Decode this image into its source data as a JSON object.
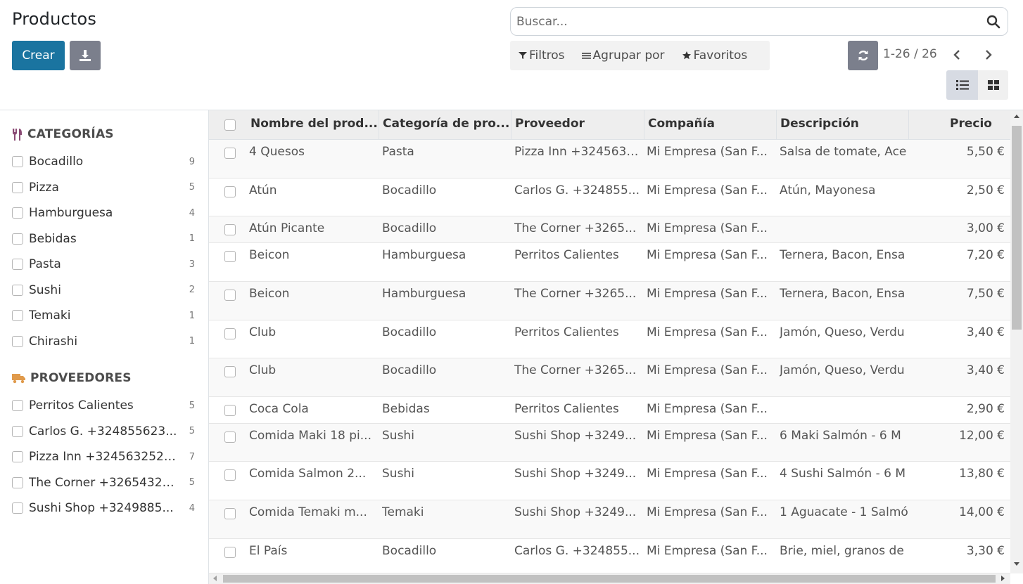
{
  "page": {
    "title": "Productos",
    "create_label": "Crear",
    "search_placeholder": "Buscar...",
    "filters_label": "Filtros",
    "groupby_label": "Agrupar por",
    "favorites_label": "Favoritos",
    "pager": "1-26 / 26"
  },
  "sidebar": {
    "categories_title": "CATEGORÍAS",
    "categories": [
      {
        "label": "Bocadillo",
        "count": "9"
      },
      {
        "label": "Pizza",
        "count": "5"
      },
      {
        "label": "Hamburguesa",
        "count": "4"
      },
      {
        "label": "Bebidas",
        "count": "1"
      },
      {
        "label": "Pasta",
        "count": "3"
      },
      {
        "label": "Sushi",
        "count": "2"
      },
      {
        "label": "Temaki",
        "count": "1"
      },
      {
        "label": "Chirashi",
        "count": "1"
      }
    ],
    "suppliers_title": "PROVEEDORES",
    "suppliers": [
      {
        "label": "Perritos Calientes",
        "count": "5"
      },
      {
        "label": "Carlos G. +324855623...",
        "count": "5"
      },
      {
        "label": "Pizza Inn +3245632528...",
        "count": "7"
      },
      {
        "label": "The Corner +32654321...",
        "count": "5"
      },
      {
        "label": "Sushi Shop +3249885...",
        "count": "4"
      }
    ]
  },
  "table": {
    "headers": {
      "name": "Nombre del prod...",
      "category": "Categoría de pro...",
      "supplier": "Proveedor",
      "company": "Compañía",
      "description": "Descripción",
      "price": "Precio"
    },
    "rows": [
      {
        "name": "4 Quesos",
        "category": "Pasta",
        "supplier": "Pizza Inn +32456325...",
        "company": "Mi Empresa (San F...",
        "description": "Salsa de tomate, Ace",
        "price": "5,50 €"
      },
      {
        "name": "Atún",
        "category": "Bocadillo",
        "supplier": "Carlos G. +324855...",
        "company": "Mi Empresa (San F...",
        "description": "Atún, Mayonesa",
        "price": "2,50 €"
      },
      {
        "name": "Atún Picante",
        "category": "Bocadillo",
        "supplier": "The Corner +3265...",
        "company": "Mi Empresa (San F...",
        "description": "",
        "price": "3,00 €"
      },
      {
        "name": "Beicon",
        "category": "Hamburguesa",
        "supplier": "Perritos Calientes",
        "company": "Mi Empresa (San F...",
        "description": "Ternera, Bacon, Ensa",
        "price": "7,20 €"
      },
      {
        "name": "Beicon",
        "category": "Hamburguesa",
        "supplier": "The Corner +3265...",
        "company": "Mi Empresa (San F...",
        "description": "Ternera, Bacon, Ensa",
        "price": "7,50 €"
      },
      {
        "name": "Club",
        "category": "Bocadillo",
        "supplier": "Perritos Calientes",
        "company": "Mi Empresa (San F...",
        "description": "Jamón, Queso, Verdu",
        "price": "3,40 €"
      },
      {
        "name": "Club",
        "category": "Bocadillo",
        "supplier": "The Corner +3265...",
        "company": "Mi Empresa (San F...",
        "description": "Jamón, Queso, Verdu",
        "price": "3,40 €"
      },
      {
        "name": "Coca Cola",
        "category": "Bebidas",
        "supplier": "Perritos Calientes",
        "company": "Mi Empresa (San F...",
        "description": "",
        "price": "2,90 €"
      },
      {
        "name": "Comida Maki 18 pi...",
        "category": "Sushi",
        "supplier": "Sushi Shop +3249...",
        "company": "Mi Empresa (San F...",
        "description": "6 Maki Salmón - 6 M",
        "price": "12,00 €"
      },
      {
        "name": "Comida Salmon 2...",
        "category": "Sushi",
        "supplier": "Sushi Shop +3249...",
        "company": "Mi Empresa (San F...",
        "description": "4 Sushi Salmón - 6 M",
        "price": "13,80 €"
      },
      {
        "name": "Comida Temaki m...",
        "category": "Temaki",
        "supplier": "Sushi Shop +3249...",
        "company": "Mi Empresa (San F...",
        "description": "1 Aguacate - 1 Salmó",
        "price": "14,00 €"
      },
      {
        "name": "El País",
        "category": "Bocadillo",
        "supplier": "Carlos G. +324855...",
        "company": "Mi Empresa (San F...",
        "description": "Brie, miel, granos de",
        "price": "3,30 €"
      }
    ]
  },
  "colors": {
    "primary": "#1a74a0",
    "secondary": "#7b7f8c"
  }
}
